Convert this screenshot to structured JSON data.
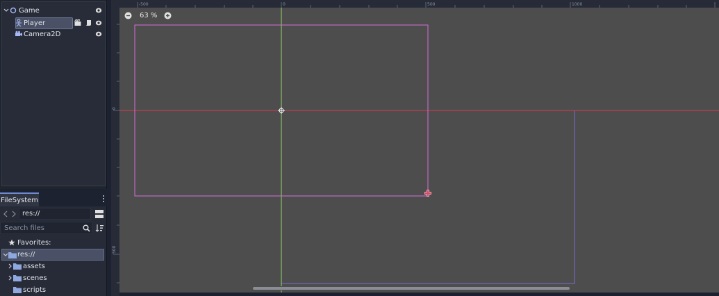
{
  "scene_tree": {
    "nodes": [
      {
        "label": "Game",
        "icon": "node2d-icon"
      },
      {
        "label": "Player",
        "icon": "kinematic-body-icon"
      },
      {
        "label": "Camera2D",
        "icon": "camera-icon"
      }
    ]
  },
  "filesystem": {
    "tab_label": "FileSystem",
    "path": "res://",
    "search_placeholder": "Search files",
    "favorites_label": "Favorites:",
    "items": [
      {
        "label": "res://"
      },
      {
        "label": "assets"
      },
      {
        "label": "scenes"
      },
      {
        "label": "scripts"
      }
    ]
  },
  "viewport": {
    "zoom_label": "63 %",
    "ruler_top": [
      "-500",
      "0",
      "500",
      "1000"
    ],
    "ruler_left": [
      "0",
      "500"
    ]
  },
  "colors": {
    "canvas_bg": "#4d4d4d",
    "x_axis": "#e0384c",
    "y_axis": "#9bd36a",
    "camera_rect": "#d66ed6",
    "screen_rect": "#7a6ad0",
    "accent": "#6f8ad0"
  }
}
